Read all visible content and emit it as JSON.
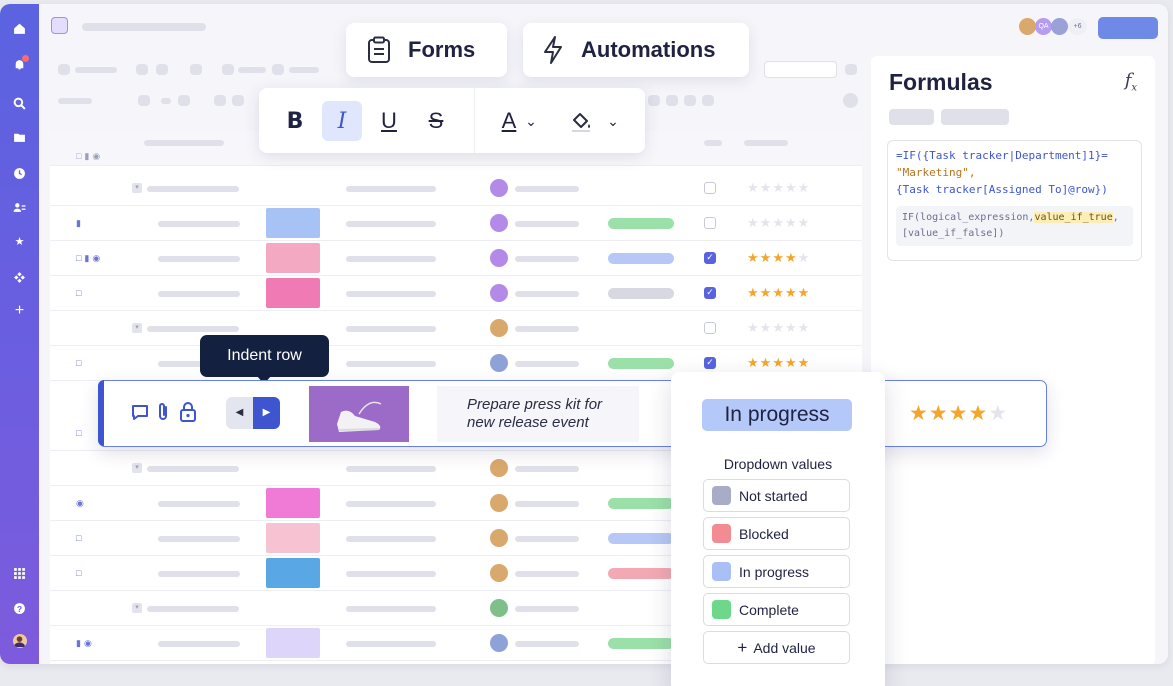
{
  "top_buttons": {
    "forms": "Forms",
    "automations": "Automations"
  },
  "header": {
    "collab_badge_count": "+6",
    "collab_initials": "QA"
  },
  "toolbar": {
    "bold": "B",
    "italic": "I",
    "underline": "U",
    "strike": "S",
    "text_color": "A"
  },
  "formulas": {
    "title": "Formulas",
    "fx_symbol": "fx",
    "code_lines": [
      "=IF({Task tracker|Department]1}=",
      "\"Marketing\",",
      "{Task tracker[Assigned To]@row})"
    ],
    "hint_parts": [
      "IF(logical_expression,",
      "value_if_true",
      ",",
      "[value_if_false])"
    ]
  },
  "tooltip": {
    "label": "Indent row"
  },
  "highlighted_row": {
    "task_line1": "Prepare press kit for",
    "task_line2": "new release event",
    "rating": 4
  },
  "dropdown": {
    "current_status": "In progress",
    "title": "Dropdown values",
    "options": [
      {
        "label": "Not started",
        "color": "#a9acc6"
      },
      {
        "label": "Blocked",
        "color": "#f28b92"
      },
      {
        "label": "In progress",
        "color": "#a9c0f7"
      },
      {
        "label": "Complete",
        "color": "#6dd88a"
      }
    ],
    "add_label": "Add value"
  },
  "grid_rows": [
    {
      "checked": false,
      "rating": 0
    },
    {
      "checked": false,
      "rating": 0
    },
    {
      "checked": true,
      "rating": 4
    },
    {
      "checked": true,
      "rating": 5
    },
    {
      "checked": false,
      "rating": 0
    },
    {
      "checked": true,
      "rating": 5
    }
  ]
}
